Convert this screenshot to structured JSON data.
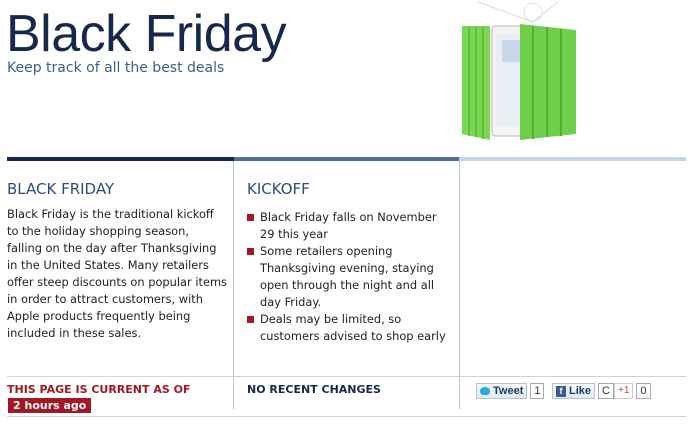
{
  "header": {
    "title": "Black Friday",
    "subtitle": "Keep track of all the best deals"
  },
  "columns": {
    "left": {
      "heading": "BLACK FRIDAY",
      "body": "Black Friday is the traditional kickoff to the holiday shopping season, falling on the day after Thanksgiving in the United States. Many retailers offer steep discounts on popular items in order to attract customers, with Apple products frequently being included in these sales."
    },
    "middle": {
      "heading": "KICKOFF",
      "bullets": [
        "Black Friday falls on November 29 this year",
        "Some retailers opening Thanksgiving evening, staying open through the night and all day Friday.",
        "Deals may be limited, so customers advised to shop early"
      ]
    }
  },
  "footer": {
    "current_label": "THIS PAGE IS CURRENT AS OF",
    "updated_ago": "2 hours ago",
    "no_changes": "NO RECENT CHANGES"
  },
  "social": {
    "tweet_label": "Tweet",
    "tweet_count": "1",
    "like_label": "Like",
    "like_count": "C",
    "gplus_label": "+1",
    "gplus_count": "0"
  },
  "colors": {
    "navy": "#16294d",
    "accent_red": "#a31824",
    "subtitle_blue": "#3a5f8e",
    "ipad_cover_green": "#6fcf4a"
  },
  "icons": [
    "ipad-smart-cover-image",
    "twitter-bird-icon",
    "facebook-icon",
    "google-plus-icon",
    "bullet-square-icon"
  ]
}
